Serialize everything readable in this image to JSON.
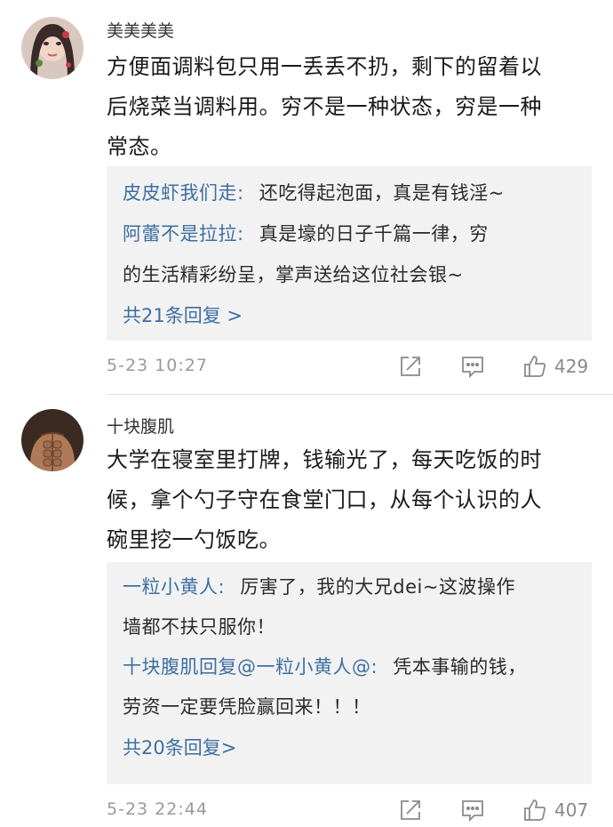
{
  "comments": [
    {
      "username": "美美美美",
      "lines": [
        "方便面调料包只用一丢丢不扔，剩下的留着以",
        "后烧菜当调料用。穷不是一种状态，穷是一种",
        "常态。"
      ],
      "replies": [
        {
          "user": "皮皮虾我们走:",
          "text_lines": [
            "还吃得起泡面，真是有钱淫~"
          ]
        },
        {
          "user": "阿蕾不是拉拉:",
          "text_lines": [
            "真是壕的日子千篇一律，穷",
            "的生活精彩纷呈，掌声送给这位社会银~"
          ]
        }
      ],
      "more_replies": "共21条回复 >",
      "timestamp": "5-23  10:27",
      "likes": "429"
    },
    {
      "username": "十块腹肌",
      "lines": [
        "大学在寝室里打牌，钱输光了，每天吃饭的时",
        "候，拿个勺子守在食堂门口，从每个认识的人",
        "碗里挖一勺饭吃。"
      ],
      "replies": [
        {
          "user": "一粒小黄人:",
          "text_lines": [
            "厉害了，我的大兄dei~这波操作",
            "墙都不扶只服你！"
          ]
        },
        {
          "user": "十块腹肌回复@一粒小黄人@:",
          "text_lines": [
            "凭本事输的钱，",
            "劳资一定要凭脸赢回来！！！"
          ]
        }
      ],
      "more_replies": "共20条回复>",
      "timestamp": "5-23  22:44",
      "likes": "407"
    }
  ],
  "colors": {
    "link_blue": "#3d6fa3",
    "reply_bg": "#f2f2f2",
    "meta_gray": "#9a9a9a"
  },
  "icons": [
    "share-icon",
    "comment-icon",
    "thumbs-up-icon"
  ]
}
